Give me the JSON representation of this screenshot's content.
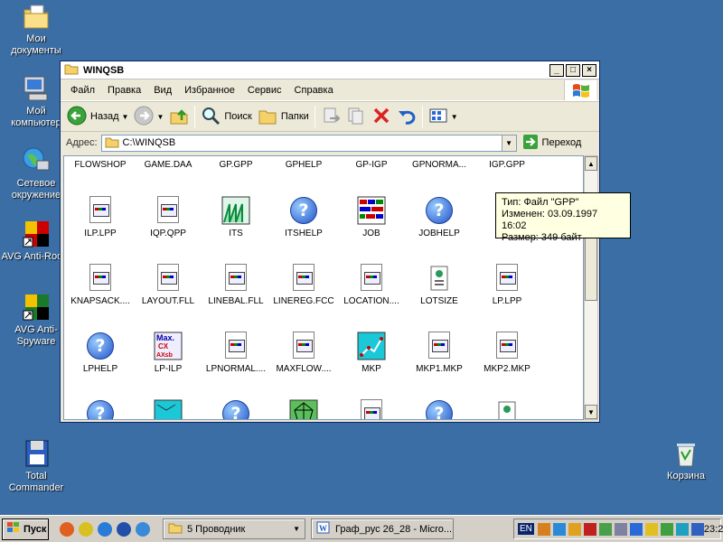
{
  "desktop": {
    "icons": [
      {
        "label": "Мои документы"
      },
      {
        "label": "Мой компьютер"
      },
      {
        "label": "Сетевое окружение"
      },
      {
        "label": "AVG Anti-Roo..."
      },
      {
        "label": "AVG Anti-Spyware"
      },
      {
        "label": "Total Commander"
      },
      {
        "label": "Корзина"
      }
    ]
  },
  "window": {
    "title": "WINQSB",
    "buttons": {
      "minimize": "_",
      "maximize": "□",
      "close": "×"
    },
    "menu": [
      "Файл",
      "Правка",
      "Вид",
      "Избранное",
      "Сервис",
      "Справка"
    ],
    "toolbar": {
      "back": "Назад",
      "search": "Поиск",
      "folders": "Папки"
    },
    "address": {
      "label": "Адрес:",
      "value": "C:\\WINQSB",
      "go": "Переход"
    },
    "files": [
      {
        "name": "FLOWSHOP",
        "icon": "doc-icon"
      },
      {
        "name": "GAME.DAA",
        "icon": "doc-icon"
      },
      {
        "name": "GP.GPP",
        "icon": "doc-icon"
      },
      {
        "name": "GPHELP",
        "icon": "help-icon"
      },
      {
        "name": "GP-IGP",
        "icon": "app-icon"
      },
      {
        "name": "GPNORMA...",
        "icon": "doc-icon"
      },
      {
        "name": "IGP.GPP",
        "icon": "doc-icon"
      },
      {
        "name": "ILP.LPP",
        "icon": "doc-icon"
      },
      {
        "name": "IQP.QPP",
        "icon": "doc-icon"
      },
      {
        "name": "ITS",
        "icon": "its-app-icon"
      },
      {
        "name": "ITSHELP",
        "icon": "help-icon"
      },
      {
        "name": "JOB",
        "icon": "job-app-icon"
      },
      {
        "name": "JOBHELP",
        "icon": "help-icon"
      },
      {
        "name": "JO",
        "icon": "doc-icon"
      },
      {
        "name": "KNAPSACK....",
        "icon": "doc-icon"
      },
      {
        "name": "LAYOUT.FLL",
        "icon": "doc-icon"
      },
      {
        "name": "LINEBAL.FLL",
        "icon": "doc-icon"
      },
      {
        "name": "LINEREG.FCC",
        "icon": "doc-icon"
      },
      {
        "name": "LOCATION....",
        "icon": "doc-icon"
      },
      {
        "name": "LOTSIZE",
        "icon": "lotsize-icon"
      },
      {
        "name": "LP.LPP",
        "icon": "doc-icon"
      },
      {
        "name": "LPHELP",
        "icon": "help-icon"
      },
      {
        "name": "LP-ILP",
        "icon": "lp-ilp-app-icon"
      },
      {
        "name": "LPNORMAL....",
        "icon": "doc-icon"
      },
      {
        "name": "MAXFLOW....",
        "icon": "doc-icon"
      },
      {
        "name": "MKP",
        "icon": "mkp-app-icon"
      },
      {
        "name": "MKP1.MKP",
        "icon": "doc-icon"
      },
      {
        "name": "MKP2.MKP",
        "icon": "doc-icon"
      }
    ],
    "lp_ilp_icon_text": [
      "Max.",
      "CX",
      "AX≤b"
    ]
  },
  "tooltip": {
    "type": "Тип: Файл \"GPP\"",
    "modified": "Изменен: 03.09.1997 16:02",
    "size": "Размер: 349 байт"
  },
  "taskbar": {
    "start": "Пуск",
    "tasks": [
      {
        "label": "5 Проводник"
      },
      {
        "label": "Граф_рус 26_28 - Micro..."
      }
    ],
    "lang": "EN",
    "clock": "23:21"
  },
  "colors": {
    "desktop": "#3a6ea5",
    "window_chrome": "#ece9d8",
    "tooltip": "#ffffe1"
  }
}
